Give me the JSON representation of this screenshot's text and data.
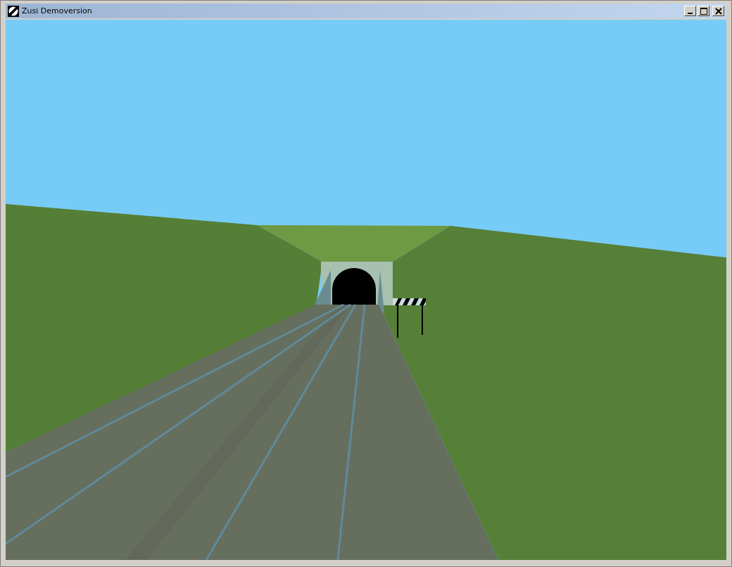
{
  "window": {
    "title": "Zusi Demoversion"
  }
}
